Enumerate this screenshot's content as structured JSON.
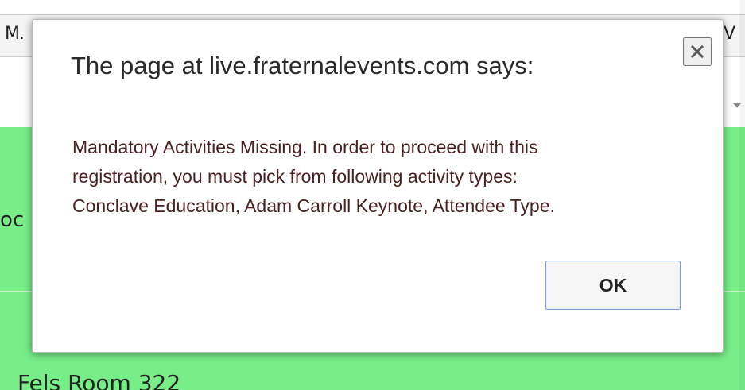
{
  "background_page": {
    "nav_left_text": "M.",
    "nav_right_text": "V",
    "row_top_text": "oc",
    "row_bottom_text": "Fels Room 322",
    "row_color": "#77ee88"
  },
  "dialog": {
    "title": "The page at live.fraternalevents.com says:",
    "close_icon": "close-icon",
    "message_line_1": "Mandatory Activities Missing. In order to proceed with this",
    "message_line_2": "registration, you must pick from following activity types:",
    "message_line_3": "Conclave Education, Adam Carroll Keynote, Attendee Type.",
    "ok_label": "OK",
    "accent_color": "#7ea0d6"
  }
}
